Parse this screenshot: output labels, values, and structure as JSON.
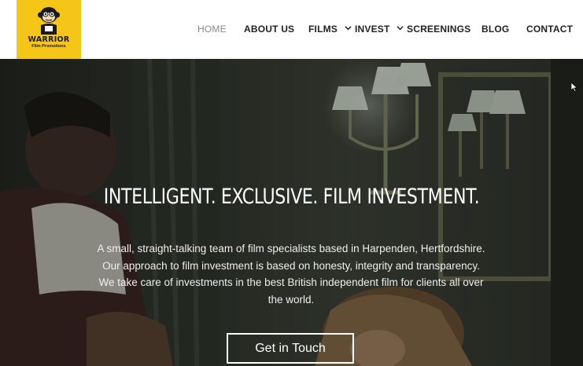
{
  "logo": {
    "brand": "WARRIOR",
    "sub": "Film Promotions",
    "icon": "monkey-mascot-icon"
  },
  "nav": {
    "items": [
      {
        "label": "HOME",
        "active": true
      },
      {
        "label": "ABOUT US"
      },
      {
        "label": "FILMS",
        "dropdown": true
      },
      {
        "label": "INVEST",
        "dropdown": true
      },
      {
        "label": "SCREENINGS"
      },
      {
        "label": "BLOG"
      },
      {
        "label": "CONTACT"
      }
    ]
  },
  "hero": {
    "headline": "INTELLIGENT. EXCLUSIVE. FILM INVESTMENT.",
    "description": "A small, straight-talking team of film specialists based in Harpenden, Hertfordshire. Our approach to film investment is based on honesty, integrity and transparency. We take care of investments in the best British independent film for clients all over the world.",
    "cta_label": "Get in Touch"
  },
  "colors": {
    "logo_bg": "#f5c518",
    "nav_text": "#222222",
    "nav_active": "#888888"
  }
}
